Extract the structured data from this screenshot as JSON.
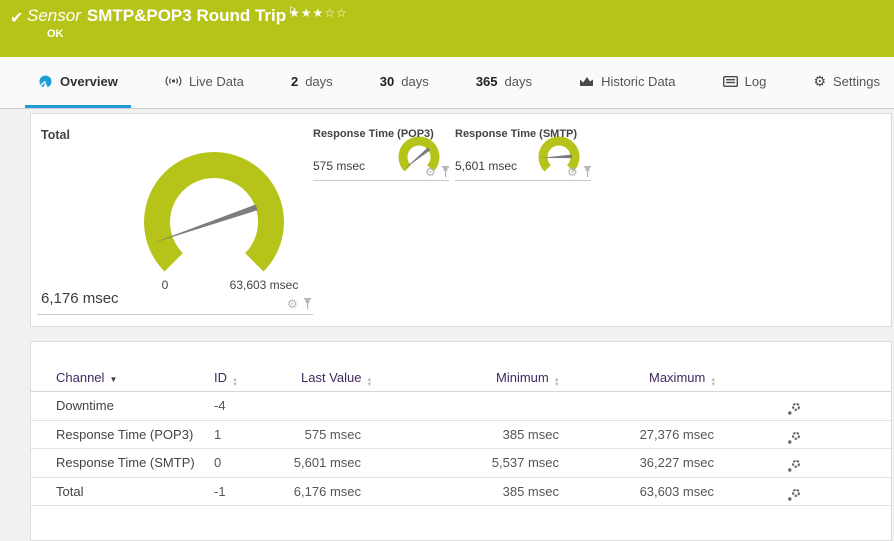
{
  "header": {
    "type_label": "Sensor",
    "title": "SMTP&POP3 Round Trip",
    "status": "OK",
    "stars": "★★★☆☆",
    "bg_color": "#b6c41a"
  },
  "tabs": {
    "overview": {
      "label": "Overview",
      "active": true
    },
    "live": {
      "label": "Live Data"
    },
    "d2": {
      "num": "2",
      "label": "days"
    },
    "d30": {
      "num": "30",
      "label": "days"
    },
    "d365": {
      "num": "365",
      "label": "days"
    },
    "historic": {
      "label": "Historic Data"
    },
    "log": {
      "label": "Log"
    },
    "settings": {
      "label": "Settings"
    }
  },
  "gauges": {
    "total": {
      "label": "Total",
      "value": "6,176 msec",
      "scale_min": "0",
      "scale_max": "63,603 msec",
      "needle_deg": 161
    },
    "pop3": {
      "label": "Response Time (POP3)",
      "value": "575 msec",
      "needle_deg": 141
    },
    "smtp": {
      "label": "Response Time (SMTP)",
      "value": "5,601 msec",
      "needle_deg": 177
    }
  },
  "table": {
    "headers": {
      "channel": "Channel",
      "id": "ID",
      "last": "Last Value",
      "min": "Minimum",
      "max": "Maximum"
    },
    "rows": [
      {
        "channel": "Downtime",
        "id": "-4",
        "last": "",
        "min": "",
        "max": ""
      },
      {
        "channel": "Response Time (POP3)",
        "id": "1",
        "last": "575 msec",
        "min": "385 msec",
        "max": "27,376 msec"
      },
      {
        "channel": "Response Time (SMTP)",
        "id": "0",
        "last": "5,601 msec",
        "min": "5,537 msec",
        "max": "36,227 msec"
      },
      {
        "channel": "Total",
        "id": "-1",
        "last": "6,176 msec",
        "min": "385 msec",
        "max": "63,603 msec"
      }
    ]
  },
  "colors": {
    "accent_green": "#b6c41a",
    "accent_blue": "#1e9cd7",
    "table_header_text": "#42285e",
    "needle_gray": "#7d7d7d"
  }
}
